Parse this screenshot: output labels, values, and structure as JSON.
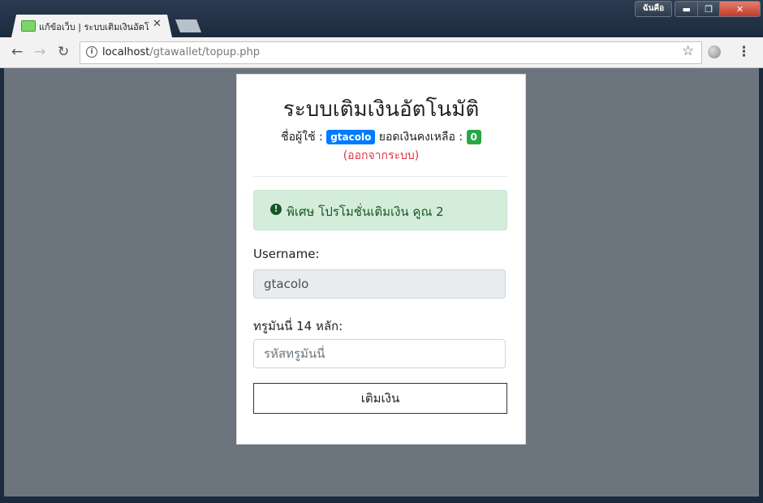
{
  "window": {
    "user_button": "ฉันคือ",
    "controls": {
      "minimize": "▬",
      "maximize": "❐",
      "close": "✕"
    }
  },
  "browser": {
    "tab_title": "แก้ข้อเว็บ | ระบบเติมเงินอัตโนมัติ",
    "tab_close": "✕",
    "url_host": "localhost",
    "url_path": "/gtawallet/topup.php",
    "icons": {
      "back": "←",
      "forward": "→",
      "reload": "↻",
      "star": "☆",
      "menu": "⋮",
      "info": "i"
    }
  },
  "page": {
    "title": "ระบบเติมเงินอัตโนมัติ",
    "user_label": "ชื่อผู้ใช้ :",
    "username_badge": "gtacolo",
    "balance_label": "ยอดเงินคงเหลือ :",
    "balance_badge": "0",
    "logout_link": "(ออกจากระบบ)",
    "alert_icon": "!",
    "alert_text": "พิเศษ โปรโมชั่นเติมเงิน คูณ 2",
    "username_label": "Username:",
    "username_value": "gtacolo",
    "code_label": "ทรูมันนี่ 14 หลัก:",
    "code_placeholder": "รหัสทรูมันนี่",
    "submit_label": "เติมเงิน"
  },
  "colors": {
    "page_bg": "#6c757d",
    "badge_blue": "#007bff",
    "badge_green": "#28a745",
    "logout_red": "#dc3545",
    "alert_bg": "#d4edda",
    "alert_text": "#155724"
  }
}
